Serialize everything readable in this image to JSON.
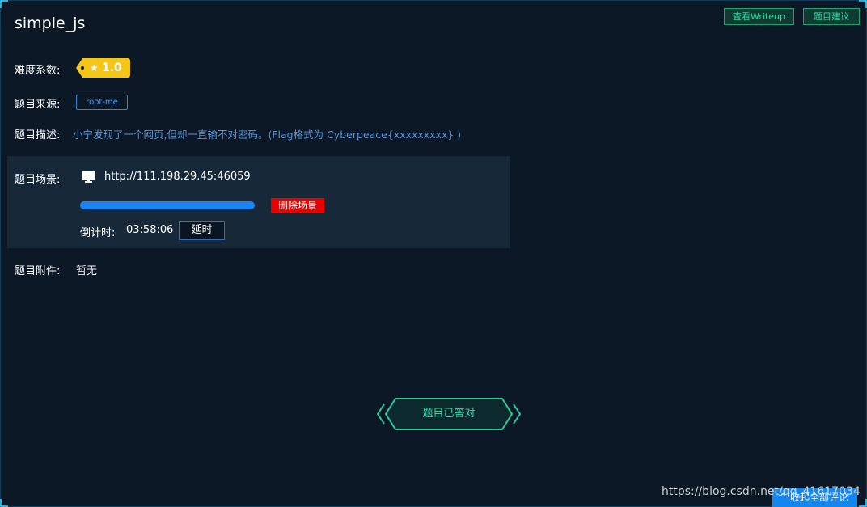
{
  "challenge": {
    "title": "simple_js",
    "difficulty_label": "难度系数:",
    "difficulty_value": "1.0",
    "source_label": "题目来源:",
    "source_value": "root-me",
    "description_label": "题目描述:",
    "description": "小宁发现了一个网页,但却一直输不对密码。(Flag格式为 Cyberpeace{xxxxxxxxx} )",
    "attachment_label": "题目附件:",
    "attachment_value": "暂无"
  },
  "toolbar": {
    "writeup_label": "查看Writeup",
    "suggest_label": "题目建议"
  },
  "scene": {
    "label": "题目场景:",
    "url": "http://111.198.29.45:46059",
    "progress": 1.0,
    "delete_label": "删除场景",
    "countdown_label": "倒计时:",
    "countdown_value": "03:58:06",
    "extend_label": "延时"
  },
  "status": {
    "answered_label": "题目已答对"
  },
  "footer": {
    "collapse_label": "收起全部评论",
    "watermark": "https://blog.csdn.net/qq_41617034"
  },
  "colors": {
    "background": "#0c1826",
    "panel": "#172839",
    "accent_green": "#23e0a0",
    "accent_blue": "#1b83f2",
    "danger": "#e60000",
    "difficulty_gold": "#f5c518"
  },
  "icons": [
    "star-icon",
    "monitor-icon",
    "chevron-up-icon"
  ]
}
